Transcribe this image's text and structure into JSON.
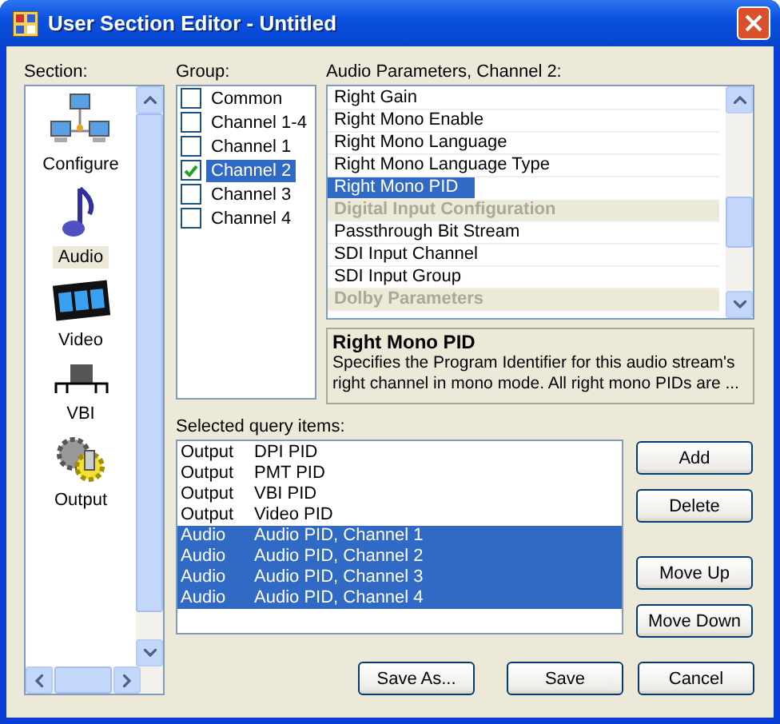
{
  "window": {
    "title": "User Section Editor - Untitled"
  },
  "section": {
    "label": "Section:",
    "items": [
      {
        "label": "Configure",
        "selected": false
      },
      {
        "label": "Audio",
        "selected": true
      },
      {
        "label": "Video",
        "selected": false
      },
      {
        "label": "VBI",
        "selected": false
      },
      {
        "label": "Output",
        "selected": false
      }
    ]
  },
  "group": {
    "label": "Group:",
    "items": [
      {
        "label": "Common",
        "checked": false,
        "selected": false
      },
      {
        "label": "Channel 1-4",
        "checked": false,
        "selected": false
      },
      {
        "label": "Channel 1",
        "checked": false,
        "selected": false
      },
      {
        "label": "Channel 2",
        "checked": true,
        "selected": true
      },
      {
        "label": "Channel 3",
        "checked": false,
        "selected": false
      },
      {
        "label": "Channel 4",
        "checked": false,
        "selected": false
      }
    ]
  },
  "parameters": {
    "label": "Audio Parameters, Channel 2:",
    "items": [
      {
        "label": "Right Gain",
        "kind": "item",
        "selected": false
      },
      {
        "label": "Right Mono Enable",
        "kind": "item",
        "selected": false
      },
      {
        "label": "Right Mono Language",
        "kind": "item",
        "selected": false
      },
      {
        "label": "Right Mono Language Type",
        "kind": "item",
        "selected": false
      },
      {
        "label": "Right Mono PID",
        "kind": "item",
        "selected": true
      },
      {
        "label": "Digital Input Configuration",
        "kind": "header",
        "selected": false
      },
      {
        "label": "Passthrough Bit Stream",
        "kind": "item",
        "selected": false
      },
      {
        "label": "SDI Input Channel",
        "kind": "item",
        "selected": false
      },
      {
        "label": "SDI Input Group",
        "kind": "item",
        "selected": false
      },
      {
        "label": "Dolby Parameters",
        "kind": "header",
        "selected": false
      }
    ]
  },
  "description": {
    "title": "Right Mono PID",
    "text": "Specifies the Program Identifier for this audio stream's right channel in mono mode. All right mono PIDs are ..."
  },
  "query": {
    "label": "Selected query items:",
    "rows": [
      {
        "type": "Output",
        "name": "DPI PID",
        "selected": false
      },
      {
        "type": "Output",
        "name": "PMT PID",
        "selected": false
      },
      {
        "type": "Output",
        "name": "VBI PID",
        "selected": false
      },
      {
        "type": "Output",
        "name": "Video PID",
        "selected": false
      },
      {
        "type": "Audio",
        "name": "Audio PID, Channel 1",
        "selected": true
      },
      {
        "type": "Audio",
        "name": "Audio PID, Channel 2",
        "selected": true
      },
      {
        "type": "Audio",
        "name": "Audio PID, Channel 3",
        "selected": true
      },
      {
        "type": "Audio",
        "name": "Audio PID, Channel 4",
        "selected": true
      }
    ]
  },
  "side_buttons": [
    "Add",
    "Delete",
    "Move Up",
    "Move Down"
  ],
  "bottom_buttons": [
    "Save As...",
    "Save",
    "Cancel"
  ]
}
